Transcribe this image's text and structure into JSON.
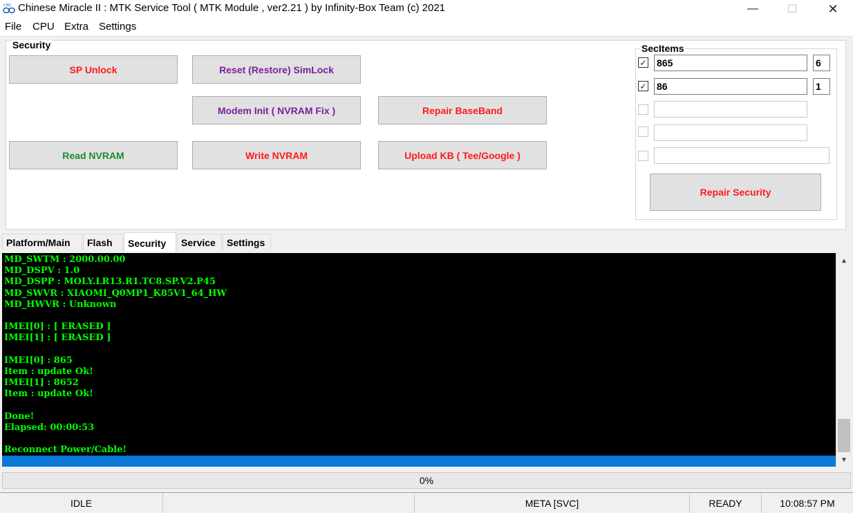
{
  "window": {
    "title": "Chinese Miracle II : MTK Service Tool ( MTK Module , ver2.21  ) by Infinity-Box Team (c) 2021",
    "minimize_glyph": "—",
    "maximize_glyph": "☐",
    "close_glyph": "✕"
  },
  "menu": [
    "File",
    "CPU",
    "Extra",
    "Settings"
  ],
  "security": {
    "group_label": "Security",
    "buttons": {
      "sp_unlock": "SP Unlock",
      "reset_simlock": "Reset (Restore) SimLock",
      "modem_init": "Modem Init ( NVRAM Fix )",
      "repair_baseband": "Repair BaseBand",
      "read_nvram": "Read NVRAM",
      "write_nvram": "Write NVRAM",
      "upload_kb": "Upload KB ( Tee/Google )"
    }
  },
  "secitems": {
    "group_label": "SecItems",
    "items": [
      {
        "checked": true,
        "value": "865",
        "digit": "6"
      },
      {
        "checked": true,
        "value": "86",
        "digit": "1"
      },
      {
        "checked": false,
        "value": ""
      },
      {
        "checked": false,
        "value": ""
      },
      {
        "checked": false,
        "value": ""
      }
    ],
    "check_glyph": "✓",
    "repair_button": "Repair Security"
  },
  "tabs": [
    {
      "label": "Platform/Main",
      "active": false
    },
    {
      "label": "Flash",
      "active": false
    },
    {
      "label": "Security",
      "active": true
    },
    {
      "label": "Service",
      "active": false
    },
    {
      "label": "Settings",
      "active": false
    }
  ],
  "log": [
    "MD_SWTM : 2000.00.00",
    "MD_DSPV : 1.0",
    "MD_DSPP : MOLY.LR13.R1.TC8.SP.V2.P45",
    "MD_SWVR : XIAOMI_Q0MP1_K85V1_64_HW",
    "MD_HWVR : Unknown",
    "",
    "IMEI[0] : [ ERASED ]",
    "IMEI[1] : [ ERASED ]",
    "",
    "IMEI[0] : 865",
    "Item : update Ok!",
    "IMEI[1] : 8652",
    "Item : update Ok!",
    "",
    "Done!",
    "Elapsed: 00:00:53",
    "",
    "Reconnect Power/Cable!"
  ],
  "scroll": {
    "up": "▲",
    "down": "▼"
  },
  "progress": {
    "percent": 0,
    "label": "0%"
  },
  "status": {
    "state": "IDLE",
    "mode": "META [SVC]",
    "ready": "READY",
    "time": "10:08:57 PM"
  },
  "colors": {
    "log_text": "#00ff00",
    "console_bg": "#000000",
    "selection_bar": "#0a78d7",
    "red_label": "#ff1a1a",
    "purple_label": "#7a1fa0",
    "green_label": "#1b8a2e"
  }
}
